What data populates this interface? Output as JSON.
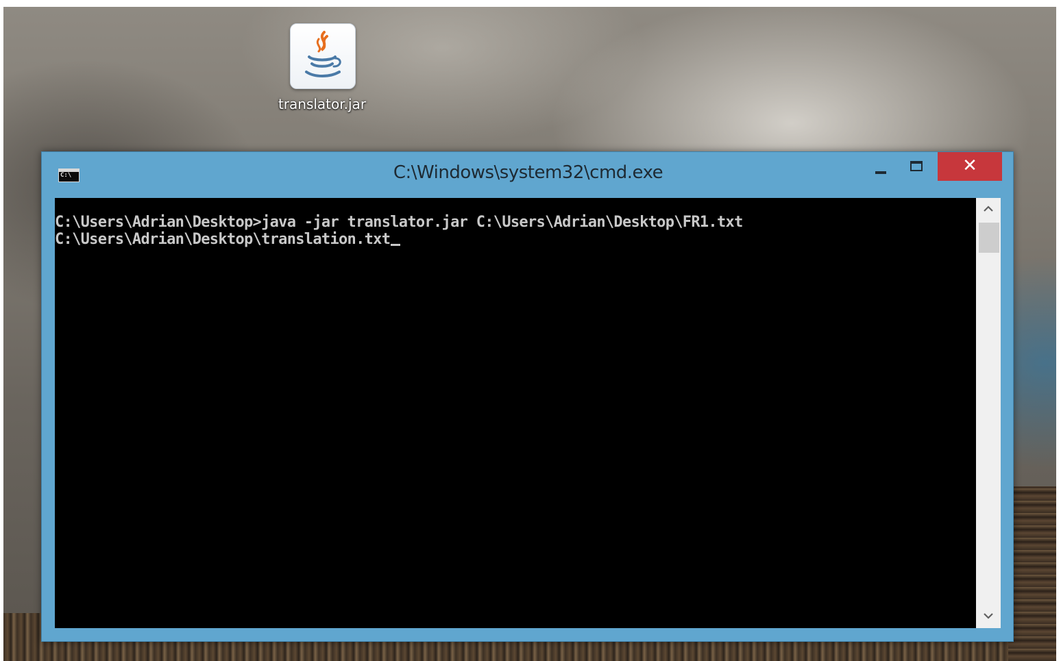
{
  "desktop": {
    "icons": [
      {
        "label": "translator.jar",
        "icon": "java-jar-icon"
      }
    ]
  },
  "window": {
    "title": "C:\\Windows\\system32\\cmd.exe",
    "app_icon_text": "C:\\",
    "controls": {
      "minimize": "minimize",
      "maximize": "maximize",
      "close": "✕"
    },
    "colors": {
      "frame": "#60a6cf",
      "close_button": "#c7373c",
      "console_background": "#000000",
      "console_text": "#c8c8c8"
    }
  },
  "console": {
    "lines": [
      "C:\\Users\\Adrian\\Desktop>java -jar translator.jar C:\\Users\\Adrian\\Desktop\\FR1.txt",
      "C:\\Users\\Adrian\\Desktop\\translation.txt"
    ]
  },
  "scrollbar": {
    "up_icon": "chevron-up-icon",
    "down_icon": "chevron-down-icon"
  }
}
